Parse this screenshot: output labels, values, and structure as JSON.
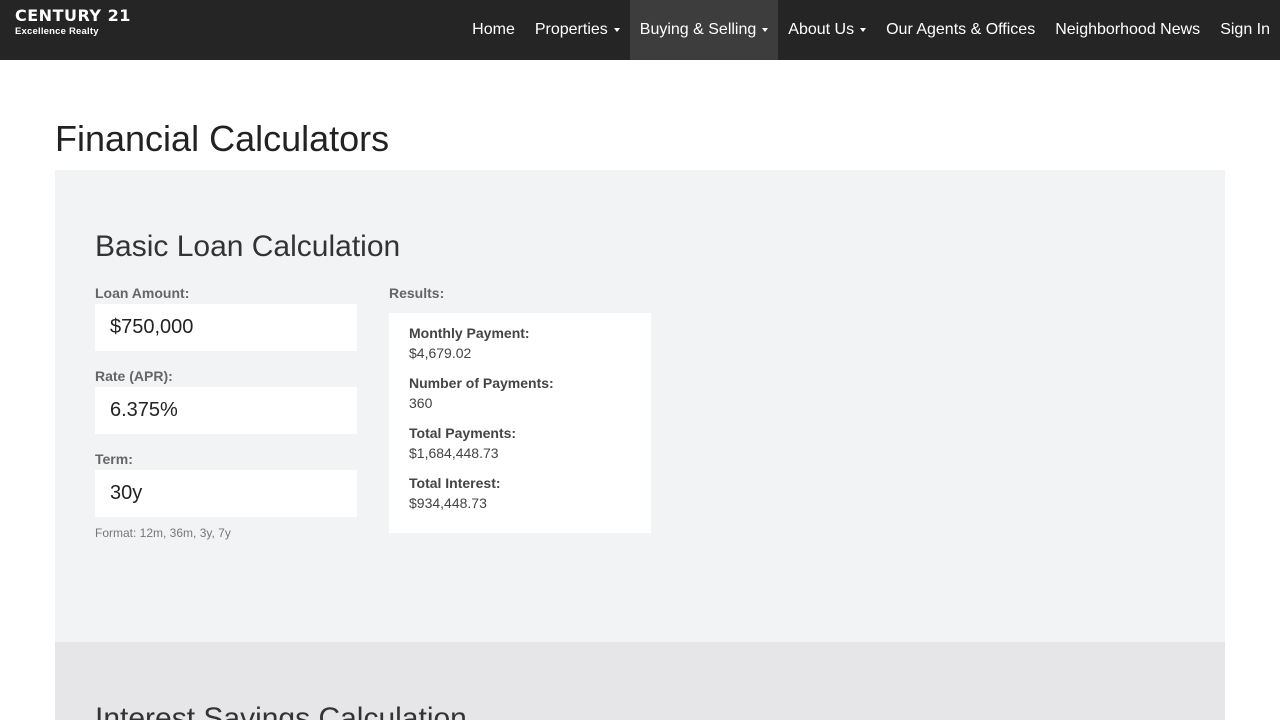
{
  "brand": {
    "name": "CENTURY 21",
    "tagline": "Excellence Realty"
  },
  "nav": [
    {
      "label": "Home",
      "dropdown": false,
      "active": false
    },
    {
      "label": "Properties",
      "dropdown": true,
      "active": false
    },
    {
      "label": "Buying & Selling",
      "dropdown": true,
      "active": true
    },
    {
      "label": "About Us",
      "dropdown": true,
      "active": false
    },
    {
      "label": "Our Agents & Offices",
      "dropdown": false,
      "active": false
    },
    {
      "label": "Neighborhood News",
      "dropdown": false,
      "active": false
    },
    {
      "label": "Sign In",
      "dropdown": false,
      "active": false
    }
  ],
  "page": {
    "title": "Financial Calculators"
  },
  "basic_loan": {
    "title": "Basic Loan Calculation",
    "loan_amount": {
      "label": "Loan Amount:",
      "value": "$750,000"
    },
    "rate": {
      "label": "Rate (APR):",
      "value": "6.375%"
    },
    "term": {
      "label": "Term:",
      "value": "30y",
      "hint": "Format: 12m, 36m, 3y, 7y"
    },
    "results": {
      "label": "Results:",
      "items": [
        {
          "label": "Monthly Payment:",
          "value": "$4,679.02"
        },
        {
          "label": "Number of Payments:",
          "value": "360"
        },
        {
          "label": "Total Payments:",
          "value": "$1,684,448.73"
        },
        {
          "label": "Total Interest:",
          "value": "$934,448.73"
        }
      ]
    }
  },
  "interest_savings": {
    "title": "Interest Savings Calculation"
  },
  "colors": {
    "navbar": "#252526",
    "nav_active": "#3d3d3e",
    "panel": "#f2f3f4",
    "panel_alt": "#e6e6e8"
  }
}
